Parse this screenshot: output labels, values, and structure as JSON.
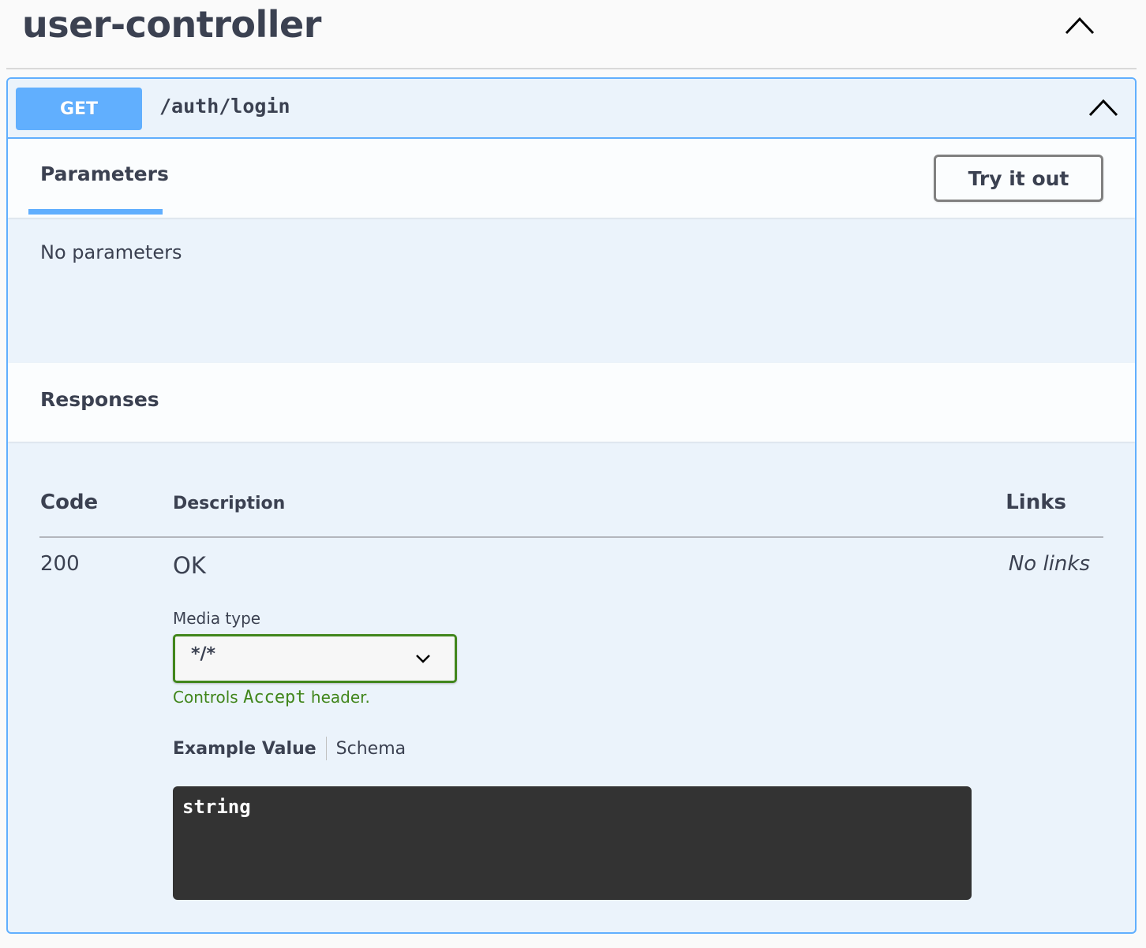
{
  "tag": {
    "title": "user-controller"
  },
  "operation": {
    "method": "GET",
    "path": "/auth/login",
    "method_color": "#61affe",
    "border_color": "#61affe",
    "background_color": "#ebf3fb"
  },
  "parameters": {
    "tab_label": "Parameters",
    "try_button": "Try it out",
    "empty_text": "No parameters"
  },
  "responses": {
    "title": "Responses",
    "columns": {
      "code": "Code",
      "description": "Description",
      "links": "Links"
    },
    "rows": [
      {
        "code": "200",
        "description": "OK",
        "links": "No links",
        "media_type_label": "Media type",
        "media_type_value": "*/*",
        "controls_prefix": "Controls",
        "controls_code": "Accept",
        "controls_suffix": "header.",
        "example_tabs": [
          "Example Value",
          "Schema"
        ],
        "example_value": "string"
      }
    ]
  },
  "icons": {
    "tag_collapse": "chevron-up-icon",
    "operation_collapse": "chevron-up-icon",
    "select_arrow": "chevron-down-icon"
  },
  "colors": {
    "text": "#3b4151",
    "success_green": "#41861c",
    "code_block_bg": "#333333"
  }
}
